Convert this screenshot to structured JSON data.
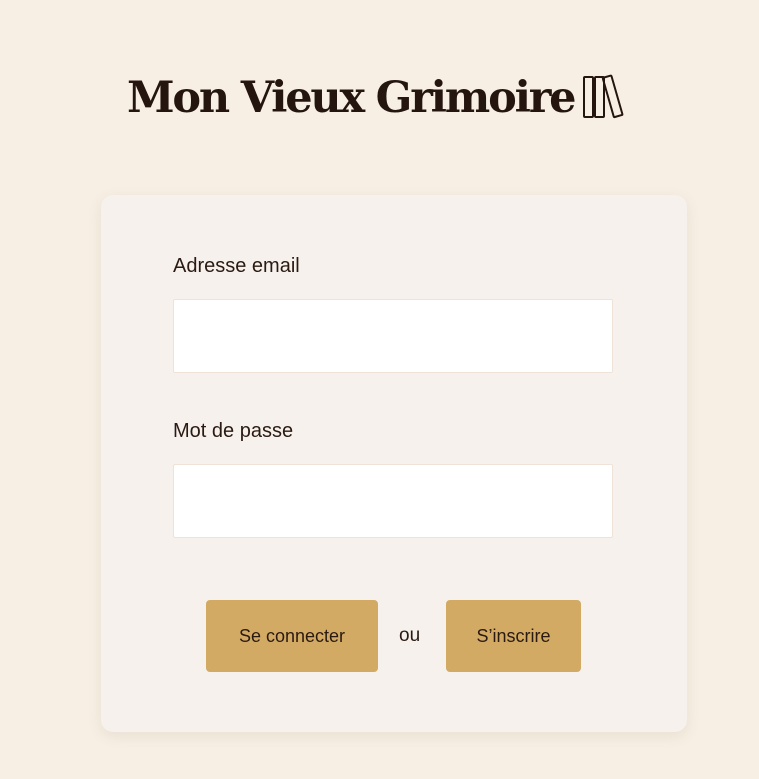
{
  "app": {
    "title": "Mon Vieux Grimoire",
    "logo_icon": "books-icon"
  },
  "form": {
    "email_label": "Adresse email",
    "email_value": "",
    "password_label": "Mot de passe",
    "password_value": "",
    "login_button": "Se connecter",
    "separator": "ou",
    "signup_button": "S’inscrire"
  },
  "colors": {
    "background": "#f7efe4",
    "card": "#f6f1ed",
    "button": "#d3aa64",
    "text": "#2a1a12"
  }
}
